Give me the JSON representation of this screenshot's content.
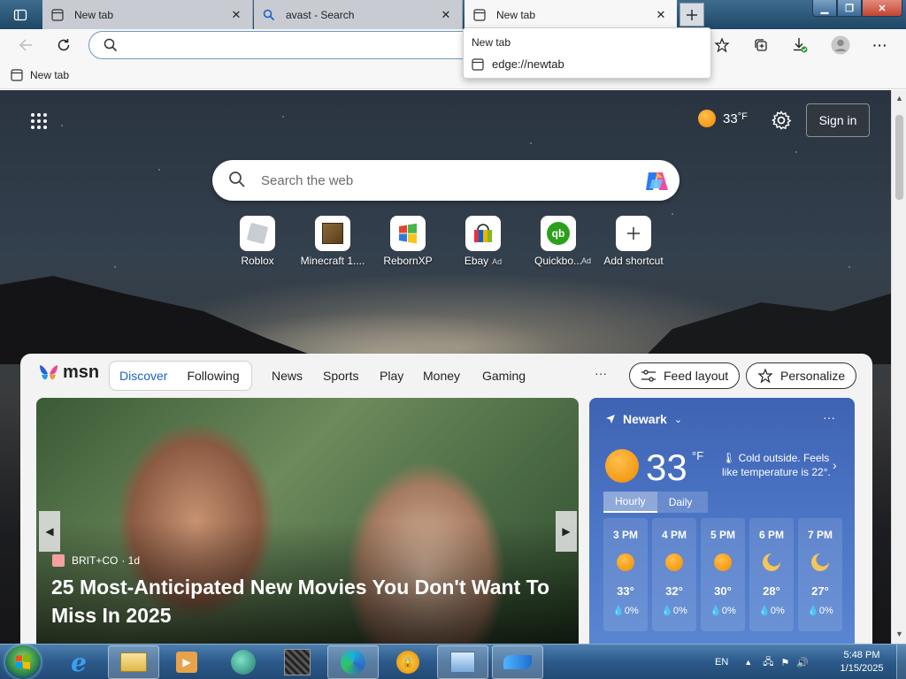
{
  "tabs": [
    {
      "title": "New tab",
      "icon": "newtab-icon",
      "active": false
    },
    {
      "title": "avast - Search",
      "icon": "search-icon",
      "active": false
    },
    {
      "title": "New tab",
      "icon": "newtab-icon",
      "active": true
    }
  ],
  "address_bar": {
    "value": "",
    "placeholder": ""
  },
  "favorites": [
    {
      "label": "New tab",
      "icon": "newtab-icon"
    }
  ],
  "hover_card": {
    "title": "New tab",
    "url": "edge://newtab"
  },
  "ntp": {
    "weather_temp": "33",
    "weather_unit": "°F",
    "signin_label": "Sign in",
    "search_placeholder": "Search the web",
    "shortcuts": [
      {
        "label": "Roblox"
      },
      {
        "label": "Minecraft 1...."
      },
      {
        "label": "RebornXP"
      },
      {
        "label": "Ebay",
        "ad": "Ad"
      },
      {
        "label": "Quickbo...",
        "ad": "Ad"
      },
      {
        "label": "Add shortcut"
      }
    ]
  },
  "feed": {
    "logo_text": "msn",
    "tabs": [
      "Discover",
      "Following"
    ],
    "nav": [
      "News",
      "Sports",
      "Play",
      "Money",
      "Gaming"
    ],
    "more": "···",
    "feed_layout_label": "Feed layout",
    "personalize_label": "Personalize",
    "hero": {
      "source": "BRIT+CO",
      "age": "· 1d",
      "title": "25 Most-Anticipated New Movies You Don't Want To Miss In 2025"
    },
    "weather": {
      "location": "Newark",
      "temp": "33",
      "unit": "°F",
      "description": "Cold outside. Feels like temperature is 22°.",
      "tabs": [
        "Hourly",
        "Daily"
      ],
      "hourly": [
        {
          "time": "3 PM",
          "icon": "sun-icon",
          "temp": "33°",
          "rain": "0%"
        },
        {
          "time": "4 PM",
          "icon": "sun-icon",
          "temp": "32°",
          "rain": "0%"
        },
        {
          "time": "5 PM",
          "icon": "sun-icon",
          "temp": "30°",
          "rain": "0%"
        },
        {
          "time": "6 PM",
          "icon": "moon-icon",
          "temp": "28°",
          "rain": "0%"
        },
        {
          "time": "7 PM",
          "icon": "moon-icon",
          "temp": "27°",
          "rain": "0%"
        }
      ]
    }
  },
  "taskbar": {
    "language": "EN",
    "time": "5:48 PM",
    "date": "1/15/2025"
  }
}
